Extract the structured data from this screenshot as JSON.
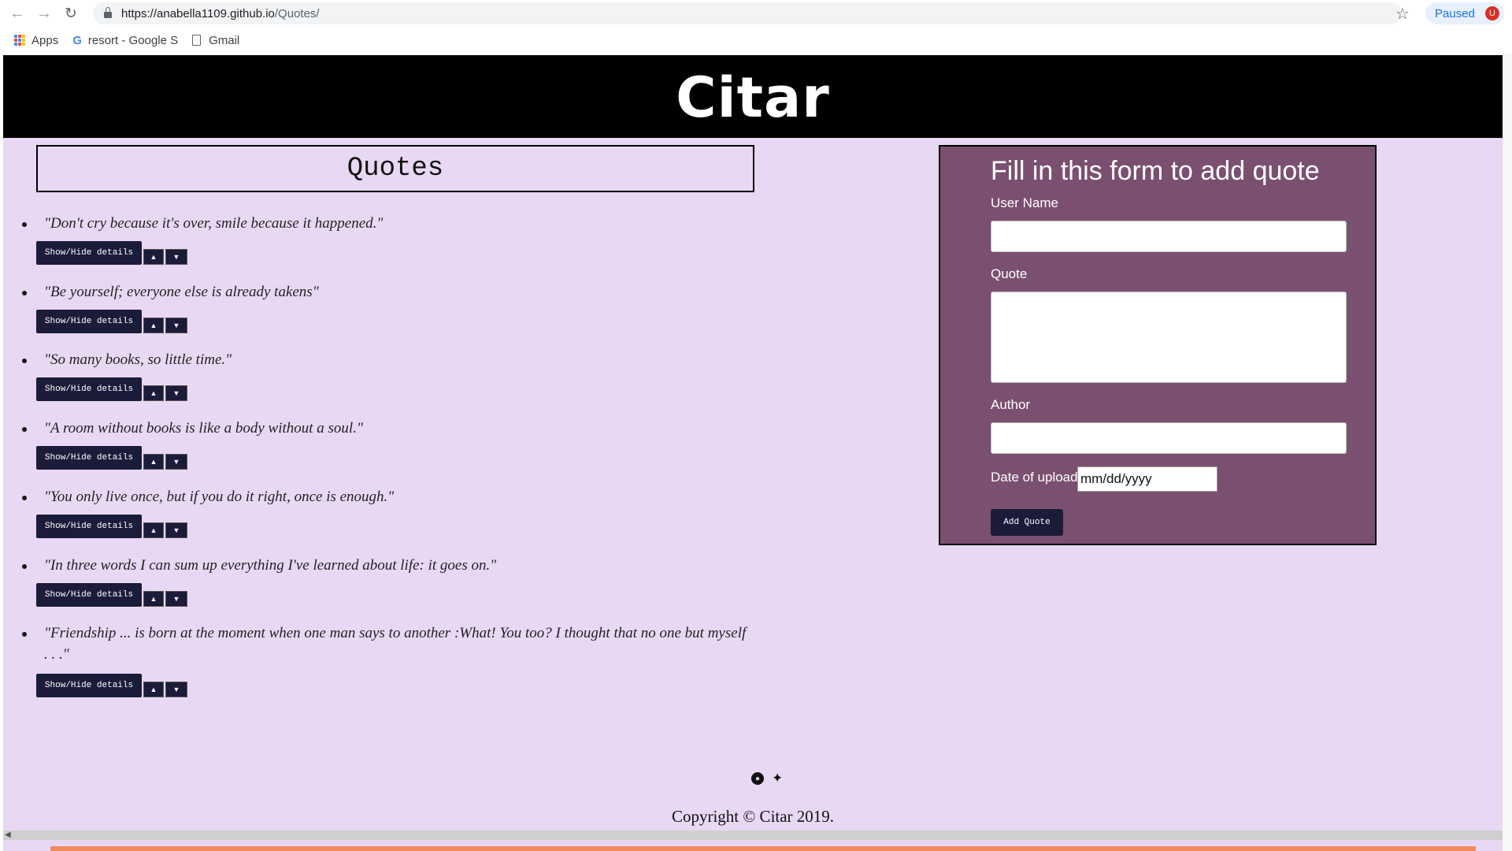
{
  "browser": {
    "url_domain": "https://anabella1109.github.io",
    "url_path": "/Quotes/",
    "paused_label": "Paused",
    "profile_initial": "U",
    "bookmarks": [
      {
        "label": "Apps"
      },
      {
        "label": "resort - Google S"
      },
      {
        "label": "Gmail"
      }
    ]
  },
  "site": {
    "title": "Citar",
    "quotes_heading": "Quotes",
    "details_button_label": "Show/Hide details",
    "quotes": [
      {
        "text": "\"Don't cry because it's over, smile because it happened.\""
      },
      {
        "text": "\"Be yourself; everyone else is already takens\""
      },
      {
        "text": "\"So many books, so little time.\""
      },
      {
        "text": "\"A room without books is like a body without a soul.\""
      },
      {
        "text": "\"You only live once, but if you do it right, once is enough.\""
      },
      {
        "text": "\"In three words I can sum up everything I've learned about life: it goes on.\""
      },
      {
        "text": "\"Friendship ... is born at the moment when one man says to another :What! You too? I thought that no one but myself . . .\""
      }
    ]
  },
  "form": {
    "title": "Fill in this form to add quote",
    "user_name_label": "User Name",
    "quote_label": "Quote",
    "author_label": "Author",
    "date_label": "Date of upload",
    "date_placeholder": "mm/dd/yyyy",
    "submit_label": "Add Quote"
  },
  "footer": {
    "copyright": "Copyright © Citar 2019.",
    "icons": [
      "github-icon",
      "twitter-icon"
    ]
  },
  "colors": {
    "page_background": "#e9d8f4",
    "header_background": "#000000",
    "form_background": "#7b4f6f",
    "button_background": "#1b1b3a"
  }
}
